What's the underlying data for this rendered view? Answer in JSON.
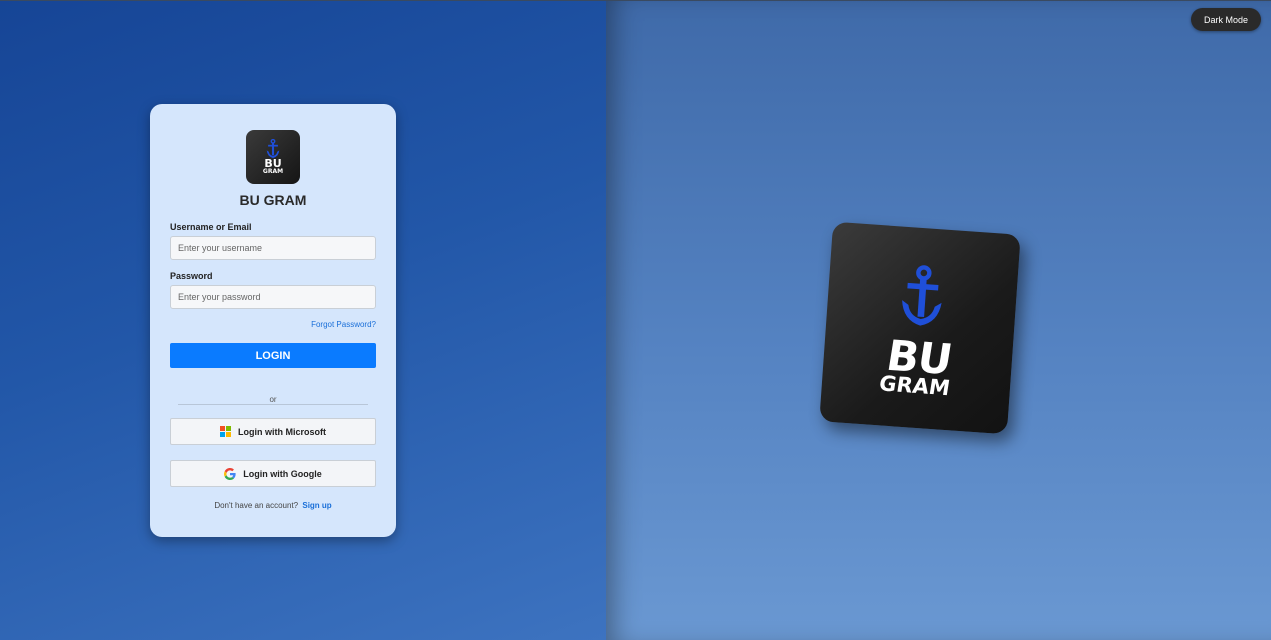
{
  "toggle": {
    "label": "Dark Mode"
  },
  "brand": {
    "name": "BU GRAM",
    "logo_line1": "BU",
    "logo_line2": "GRAM",
    "accent": "#1f4fd8"
  },
  "form": {
    "username_label": "Username or Email",
    "username_placeholder": "Enter your username",
    "password_label": "Password",
    "password_placeholder": "Enter your password",
    "forgot_label": "Forgot Password?",
    "login_label": "LOGIN",
    "or_label": "or",
    "microsoft_label": "Login with Microsoft",
    "google_label": "Login with Google",
    "signup_prompt": "Don't have an account?",
    "signup_label": "Sign up"
  },
  "icons": {
    "microsoft": "microsoft-icon",
    "google": "google-icon",
    "anchor": "anchor-icon"
  },
  "colors": {
    "primary_button": "#0a7bff",
    "link": "#1a6fd8",
    "card_bg": "#d5e6fc"
  }
}
